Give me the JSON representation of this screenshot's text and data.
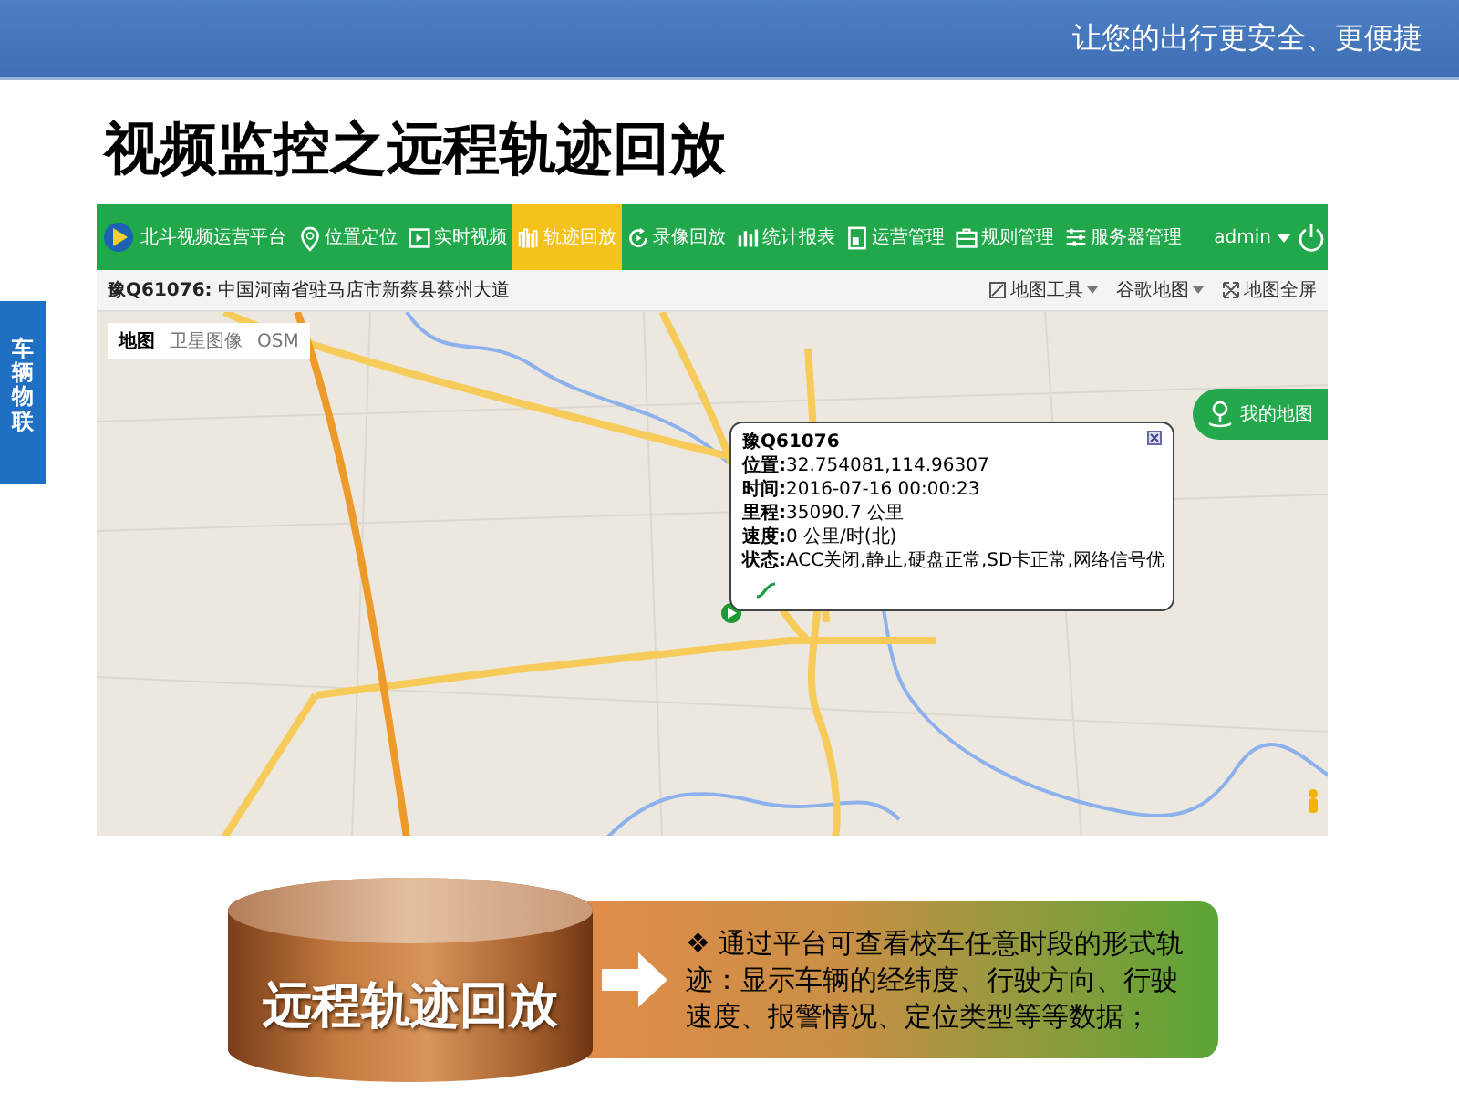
{
  "header": {
    "tagline": "让您的出行更安全、更便捷"
  },
  "title": "视频监控之远程轨迹回放",
  "side_tab": {
    "label": "车辆物联"
  },
  "app": {
    "logo_text": "北斗视频运营平台",
    "nav": [
      {
        "label": "位置定位",
        "selected": false
      },
      {
        "label": "实时视频",
        "selected": false
      },
      {
        "label": "轨迹回放",
        "selected": true
      },
      {
        "label": "录像回放",
        "selected": false
      },
      {
        "label": "统计报表",
        "selected": false
      },
      {
        "label": "运营管理",
        "selected": false
      },
      {
        "label": "规则管理",
        "selected": false
      },
      {
        "label": "服务器管理",
        "selected": false
      }
    ],
    "user": "admin",
    "location": {
      "plate": "豫Q61076:",
      "address": "中国河南省驻马店市新蔡县蔡州大道"
    },
    "tools": [
      {
        "label": "地图工具",
        "has_menu": true
      },
      {
        "label": "谷歌地图",
        "has_menu": true
      },
      {
        "label": "地图全屏",
        "has_menu": false
      }
    ],
    "map_types": [
      {
        "label": "地图",
        "selected": true
      },
      {
        "label": "卫星图像",
        "selected": false
      },
      {
        "label": "OSM",
        "selected": false
      }
    ],
    "my_map_button": "我的地图",
    "popup": {
      "title": "豫Q61076",
      "rows": [
        {
          "label": "位置:",
          "value": "32.754081,114.96307"
        },
        {
          "label": "时间:",
          "value": "2016-07-16 00:00:23"
        },
        {
          "label": "里程:",
          "value": "35090.7 公里"
        },
        {
          "label": "速度:",
          "value": "0 公里/时(北)"
        },
        {
          "label": "状态:",
          "value": "ACC关闭,静止,硬盘正常,SD卡正常,网络信号优"
        }
      ]
    }
  },
  "summary": {
    "cylinder_text": "远程轨迹回放",
    "bullet": "❖",
    "text": "通过平台可查看校车任意时段的形式轨迹：显示车辆的经纬度、行驶方向、行驶速度、报警情况、定位类型等等数据；"
  }
}
